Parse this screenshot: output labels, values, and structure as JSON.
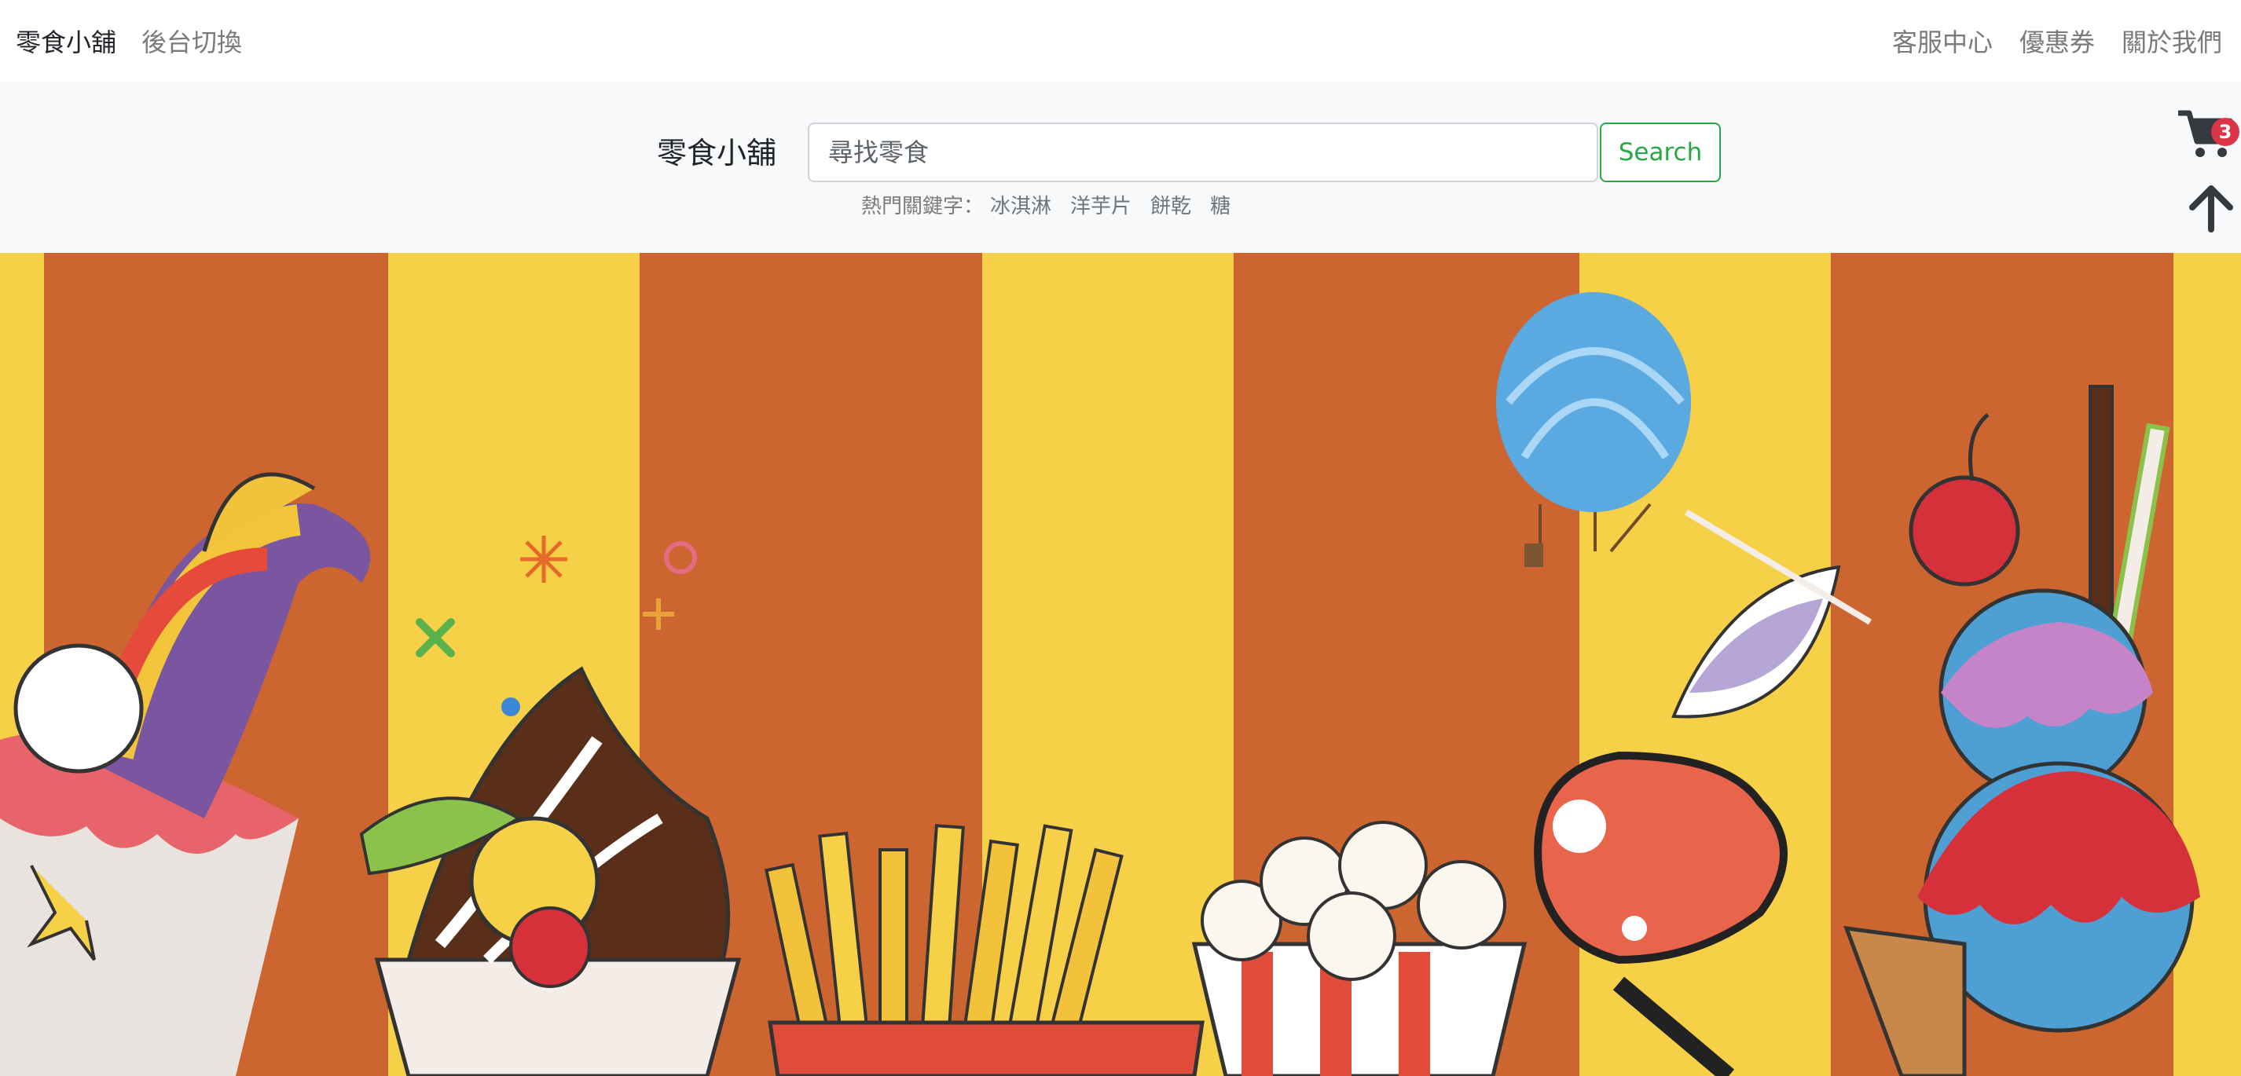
{
  "navbar": {
    "brand": "零食小舖",
    "switch_backend": "後台切換",
    "right_links": [
      "客服中心",
      "優惠券",
      "關於我們"
    ]
  },
  "search": {
    "title": "零食小舖",
    "placeholder": "尋找零食",
    "button_label": "Search",
    "hot_label": "熱門關鍵字：",
    "hot_keywords": [
      "冰淇淋",
      "洋芋片",
      "餅乾",
      "糖"
    ]
  },
  "cart": {
    "count": "3",
    "icon": "cart-icon"
  },
  "back_to_top": {
    "icon": "arrow-up-icon"
  },
  "banner": {
    "description_icons": [
      "stripes",
      "ice-cream",
      "sundae",
      "french-fries",
      "popcorn",
      "lollipop",
      "hot-air-balloon",
      "cocktail-umbrella"
    ],
    "colors": {
      "orange": "#cc6530",
      "yellow": "#f6d148"
    }
  },
  "colors": {
    "search_accent": "#28a745",
    "badge": "#dc3545",
    "band_bg": "#f8f9fa"
  }
}
